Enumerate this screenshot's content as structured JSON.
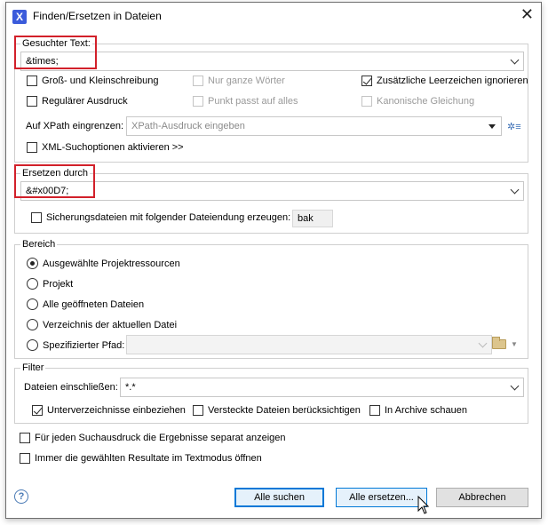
{
  "window": {
    "title": "Finden/Ersetzen in Dateien",
    "app_icon_glyph": "X",
    "close_glyph": "✕"
  },
  "find": {
    "legend": "Gesuchter Text:",
    "value": "&times;",
    "options": {
      "case_sensitive": "Groß- und Kleinschreibung",
      "whole_words": "Nur ganze Wörter",
      "ignore_extra_whitespace": "Zusätzliche Leerzeichen ignorieren",
      "regex": "Regulärer Ausdruck",
      "dot_matches_all": "Punkt passt auf alles",
      "canonical_equivalence": "Kanonische Gleichung"
    },
    "xpath_label": "Auf XPath eingrenzen:",
    "xpath_placeholder": "XPath-Ausdruck eingeben",
    "xml_options": "XML-Suchoptionen aktivieren >>"
  },
  "replace": {
    "legend": "Ersetzen durch",
    "value": "&#x00D7;",
    "backup_label": "Sicherungsdateien mit folgender Dateiendung erzeugen:",
    "backup_ext": "bak"
  },
  "scope": {
    "legend": "Bereich",
    "options": [
      "Ausgewählte Projektressourcen",
      "Projekt",
      "Alle geöffneten Dateien",
      "Verzeichnis der aktuellen Datei",
      "Spezifizierter Pfad:"
    ]
  },
  "filter": {
    "legend": "Filter",
    "include_label": "Dateien einschließen:",
    "include_value": "*.*",
    "recurse": "Unterverzeichnisse einbeziehen",
    "hidden": "Versteckte Dateien berücksichtigen",
    "archives": "In Archive schauen"
  },
  "bottom": {
    "separate_results": "Für jeden Suchausdruck die Ergebnisse separat anzeigen",
    "open_text_mode": "Immer die gewählten Resultate im Textmodus öffnen"
  },
  "buttons": {
    "find_all": "Alle suchen",
    "replace_all": "Alle ersetzen...",
    "cancel": "Abbrechen",
    "help": "?"
  },
  "colors": {
    "highlight_box": "#d2202a",
    "accent": "#0078d7"
  }
}
